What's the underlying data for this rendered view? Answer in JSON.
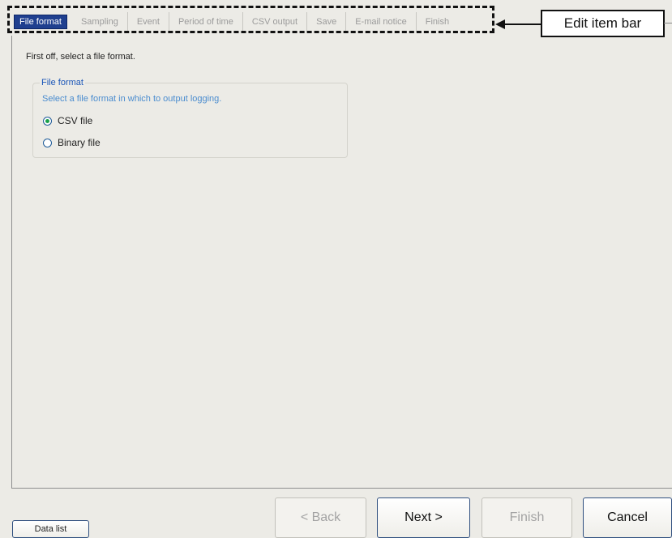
{
  "tabs": [
    {
      "label": "File format",
      "active": true
    },
    {
      "label": "Sampling",
      "active": false
    },
    {
      "label": "Event",
      "active": false
    },
    {
      "label": "Period of time",
      "active": false
    },
    {
      "label": "CSV output",
      "active": false
    },
    {
      "label": "Save",
      "active": false
    },
    {
      "label": "E-mail notice",
      "active": false
    },
    {
      "label": "Finish",
      "active": false
    }
  ],
  "callout": {
    "label": "Edit item bar"
  },
  "main": {
    "intro": "First off, select a file format.",
    "group": {
      "legend": "File format",
      "description": "Select a file format in which to output logging.",
      "options": [
        {
          "label": "CSV file",
          "checked": true
        },
        {
          "label": "Binary file",
          "checked": false
        }
      ]
    }
  },
  "buttons": {
    "data_list": "Data list",
    "back": "< Back",
    "next": "Next >",
    "finish": "Finish",
    "cancel": "Cancel"
  },
  "colors": {
    "active_tab": "#1f3f8f",
    "group_legend": "#1b56b8",
    "group_description": "#4a8ccf",
    "radio_dot": "#1aa04a",
    "window_bg": "#ecebe6"
  }
}
